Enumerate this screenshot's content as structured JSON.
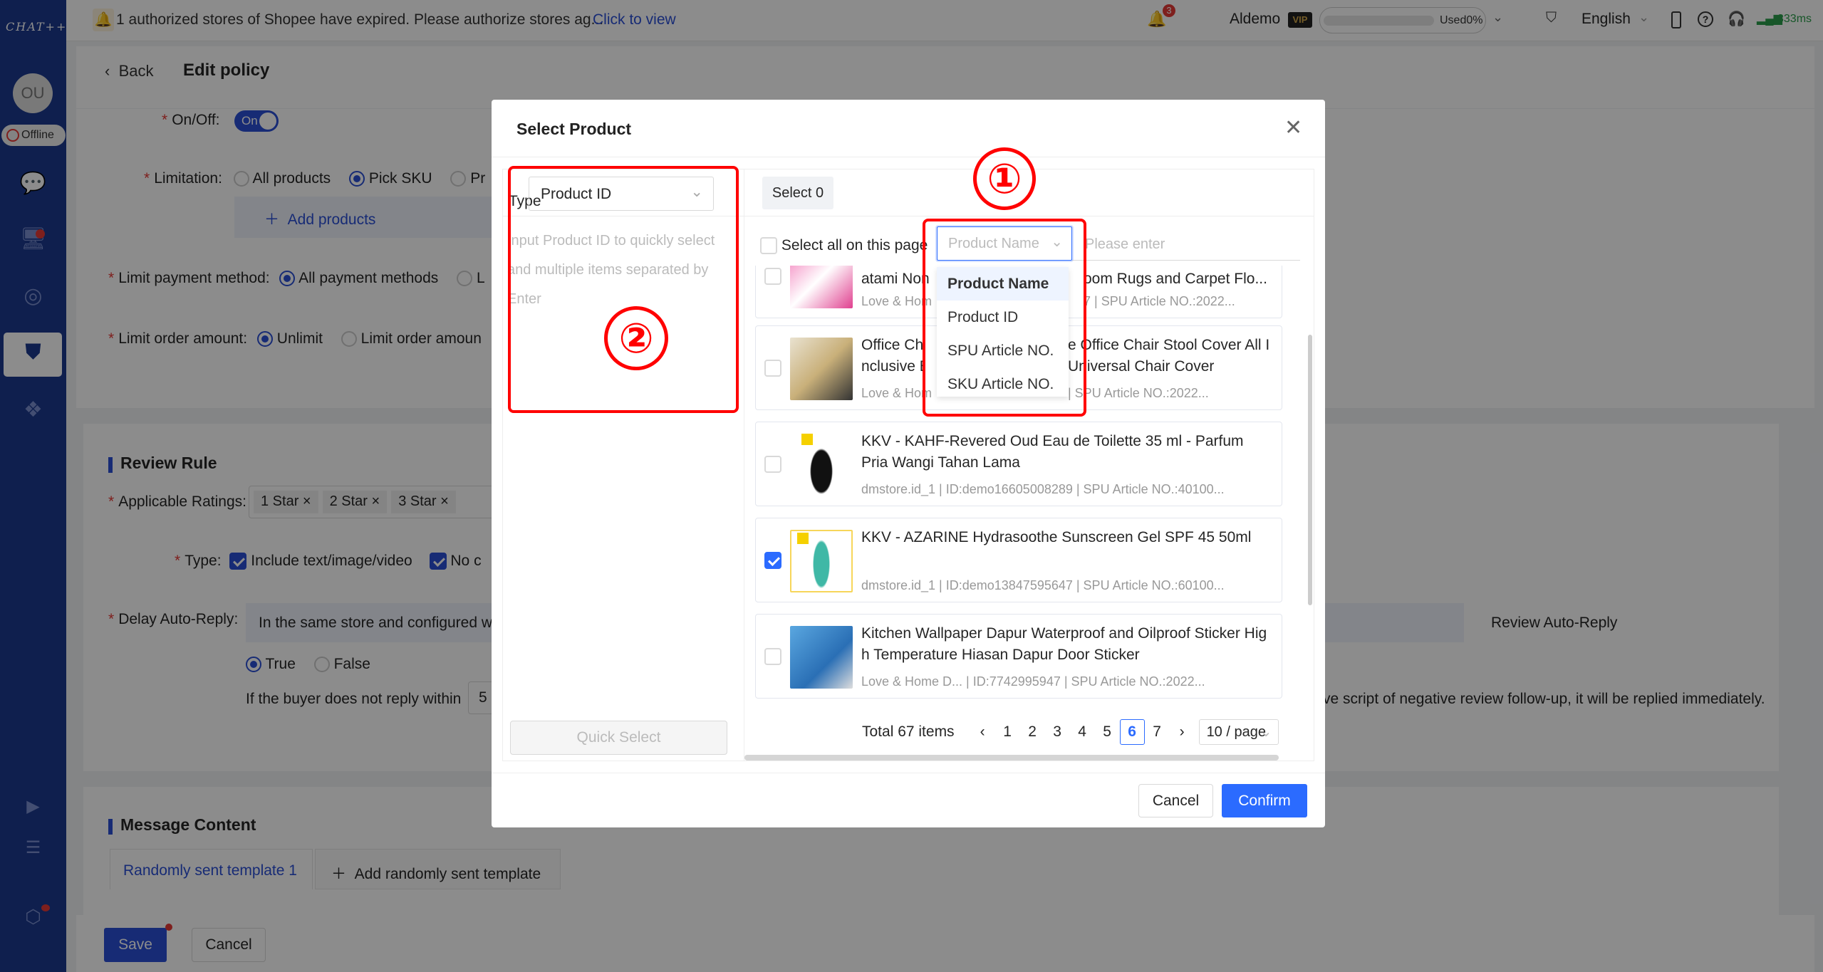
{
  "topbar": {
    "logo": "CHAT++",
    "notice": "1 authorized stores of Shopee have expired. Please authorize stores ag...",
    "notice_link": "Click to view",
    "notification_count": "3",
    "user": "Aldemo",
    "vip": "VIP",
    "usage": "Used0%",
    "usage_percent": 0,
    "language": "English",
    "latency": "333ms"
  },
  "sidebar": {
    "avatar": "OU",
    "status": "Offline",
    "items": [
      {
        "icon": "chat-icon"
      },
      {
        "icon": "monitor-icon"
      },
      {
        "icon": "target-icon"
      },
      {
        "icon": "star-bookmark-icon",
        "active": true
      },
      {
        "icon": "apps-icon"
      },
      {
        "icon": "video-icon"
      },
      {
        "icon": "notes-icon"
      },
      {
        "icon": "settings-hex-icon"
      }
    ]
  },
  "page": {
    "back": "Back",
    "title": "Edit policy",
    "onoff_label": "On/Off",
    "onoff_value": "On",
    "limitation_label": "Limitation",
    "limitation_options": [
      "All products",
      "Pick SKU",
      "Pr"
    ],
    "add_products": "Add products",
    "payment_label": "Limit payment method",
    "payment_options": [
      "All payment methods",
      "L"
    ],
    "order_label": "Limit order amount",
    "order_options": [
      "Unlimit",
      "Limit order amoun"
    ],
    "review_rule": "Review Rule",
    "ratings_label": "Applicable Ratings",
    "ratings": [
      "1 Star",
      "2 Star",
      "3 Star"
    ],
    "type_label": "Type",
    "type_options": [
      "Include text/image/video",
      "No c"
    ],
    "delay_label": "Delay Auto-Reply",
    "delay_info_start": "In the same store and configured w",
    "delay_info_end": "Review Auto-Reply",
    "delay_options": [
      "True",
      "False"
    ],
    "buyer_text": "If the buyer does not reply within",
    "buyer_value": "5",
    "buyer_text_end": "ve script of negative review follow-up, it will be replied immediately.",
    "message_content": "Message Content",
    "template_tab": "Randomly sent template 1",
    "add_template": "Add randomly sent template",
    "save": "Save",
    "cancel": "Cancel"
  },
  "modal": {
    "title": "Select Product",
    "type_label": "Type",
    "type_value": "Product ID",
    "textarea_placeholder": "Input Product ID to quickly select and multiple items separated by Enter",
    "quick_select": "Quick Select",
    "select_count": "Select 0",
    "select_all": "Select all on this page",
    "search_field": "Product Name",
    "search_placeholder": "Please enter",
    "dropdown_options": [
      "Product Name",
      "Product ID",
      "SPU Article NO.",
      "SKU Article NO."
    ],
    "annotation_1": "①",
    "annotation_2": "②",
    "products": [
      {
        "title_start": "atami Non",
        "title_end": "oom Rugs and Carpet Flo...",
        "meta_start": "Love & Hom",
        "meta_end": "7  |  SPU Article NO.:2022...",
        "checked": false
      },
      {
        "title_start": "Office Cha\nnclusive El",
        "title_end": "e Office Chair Stool Cover All I\nUniversal Chair Cover",
        "meta_start": "Love & Hom",
        "meta_end": "|  SPU Article NO.:2022...",
        "checked": false
      },
      {
        "title": "KKV - KAHF-Revered Oud Eau de Toilette 35 ml - Parfum Pria Wangi Tahan Lama",
        "meta": "dmstore.id_1  |  ID:demo16605008289  | SPU Article NO.:40100...",
        "checked": false
      },
      {
        "title": "KKV - AZARINE Hydrasoothe Sunscreen Gel SPF 45 50ml",
        "meta": "dmstore.id_1  |  ID:demo13847595647  | SPU Article NO.:60100...",
        "checked": true
      },
      {
        "title": "Kitchen Wallpaper Dapur Waterproof and Oilproof Sticker High Temperature Hiasan Dapur Door Sticker",
        "meta": "Love & Home D...  |  ID:7742995947  |  SPU Article NO.:2022...",
        "checked": false
      }
    ],
    "pagination": {
      "total": "Total 67 items",
      "pages": [
        "1",
        "2",
        "3",
        "4",
        "5",
        "6",
        "7"
      ],
      "current": "6",
      "page_size": "10 / page"
    },
    "cancel": "Cancel",
    "confirm": "Confirm"
  },
  "colors": {
    "primary": "#2b6bff",
    "sidebar": "#1d3a8f",
    "annotation": "#ff0000"
  }
}
